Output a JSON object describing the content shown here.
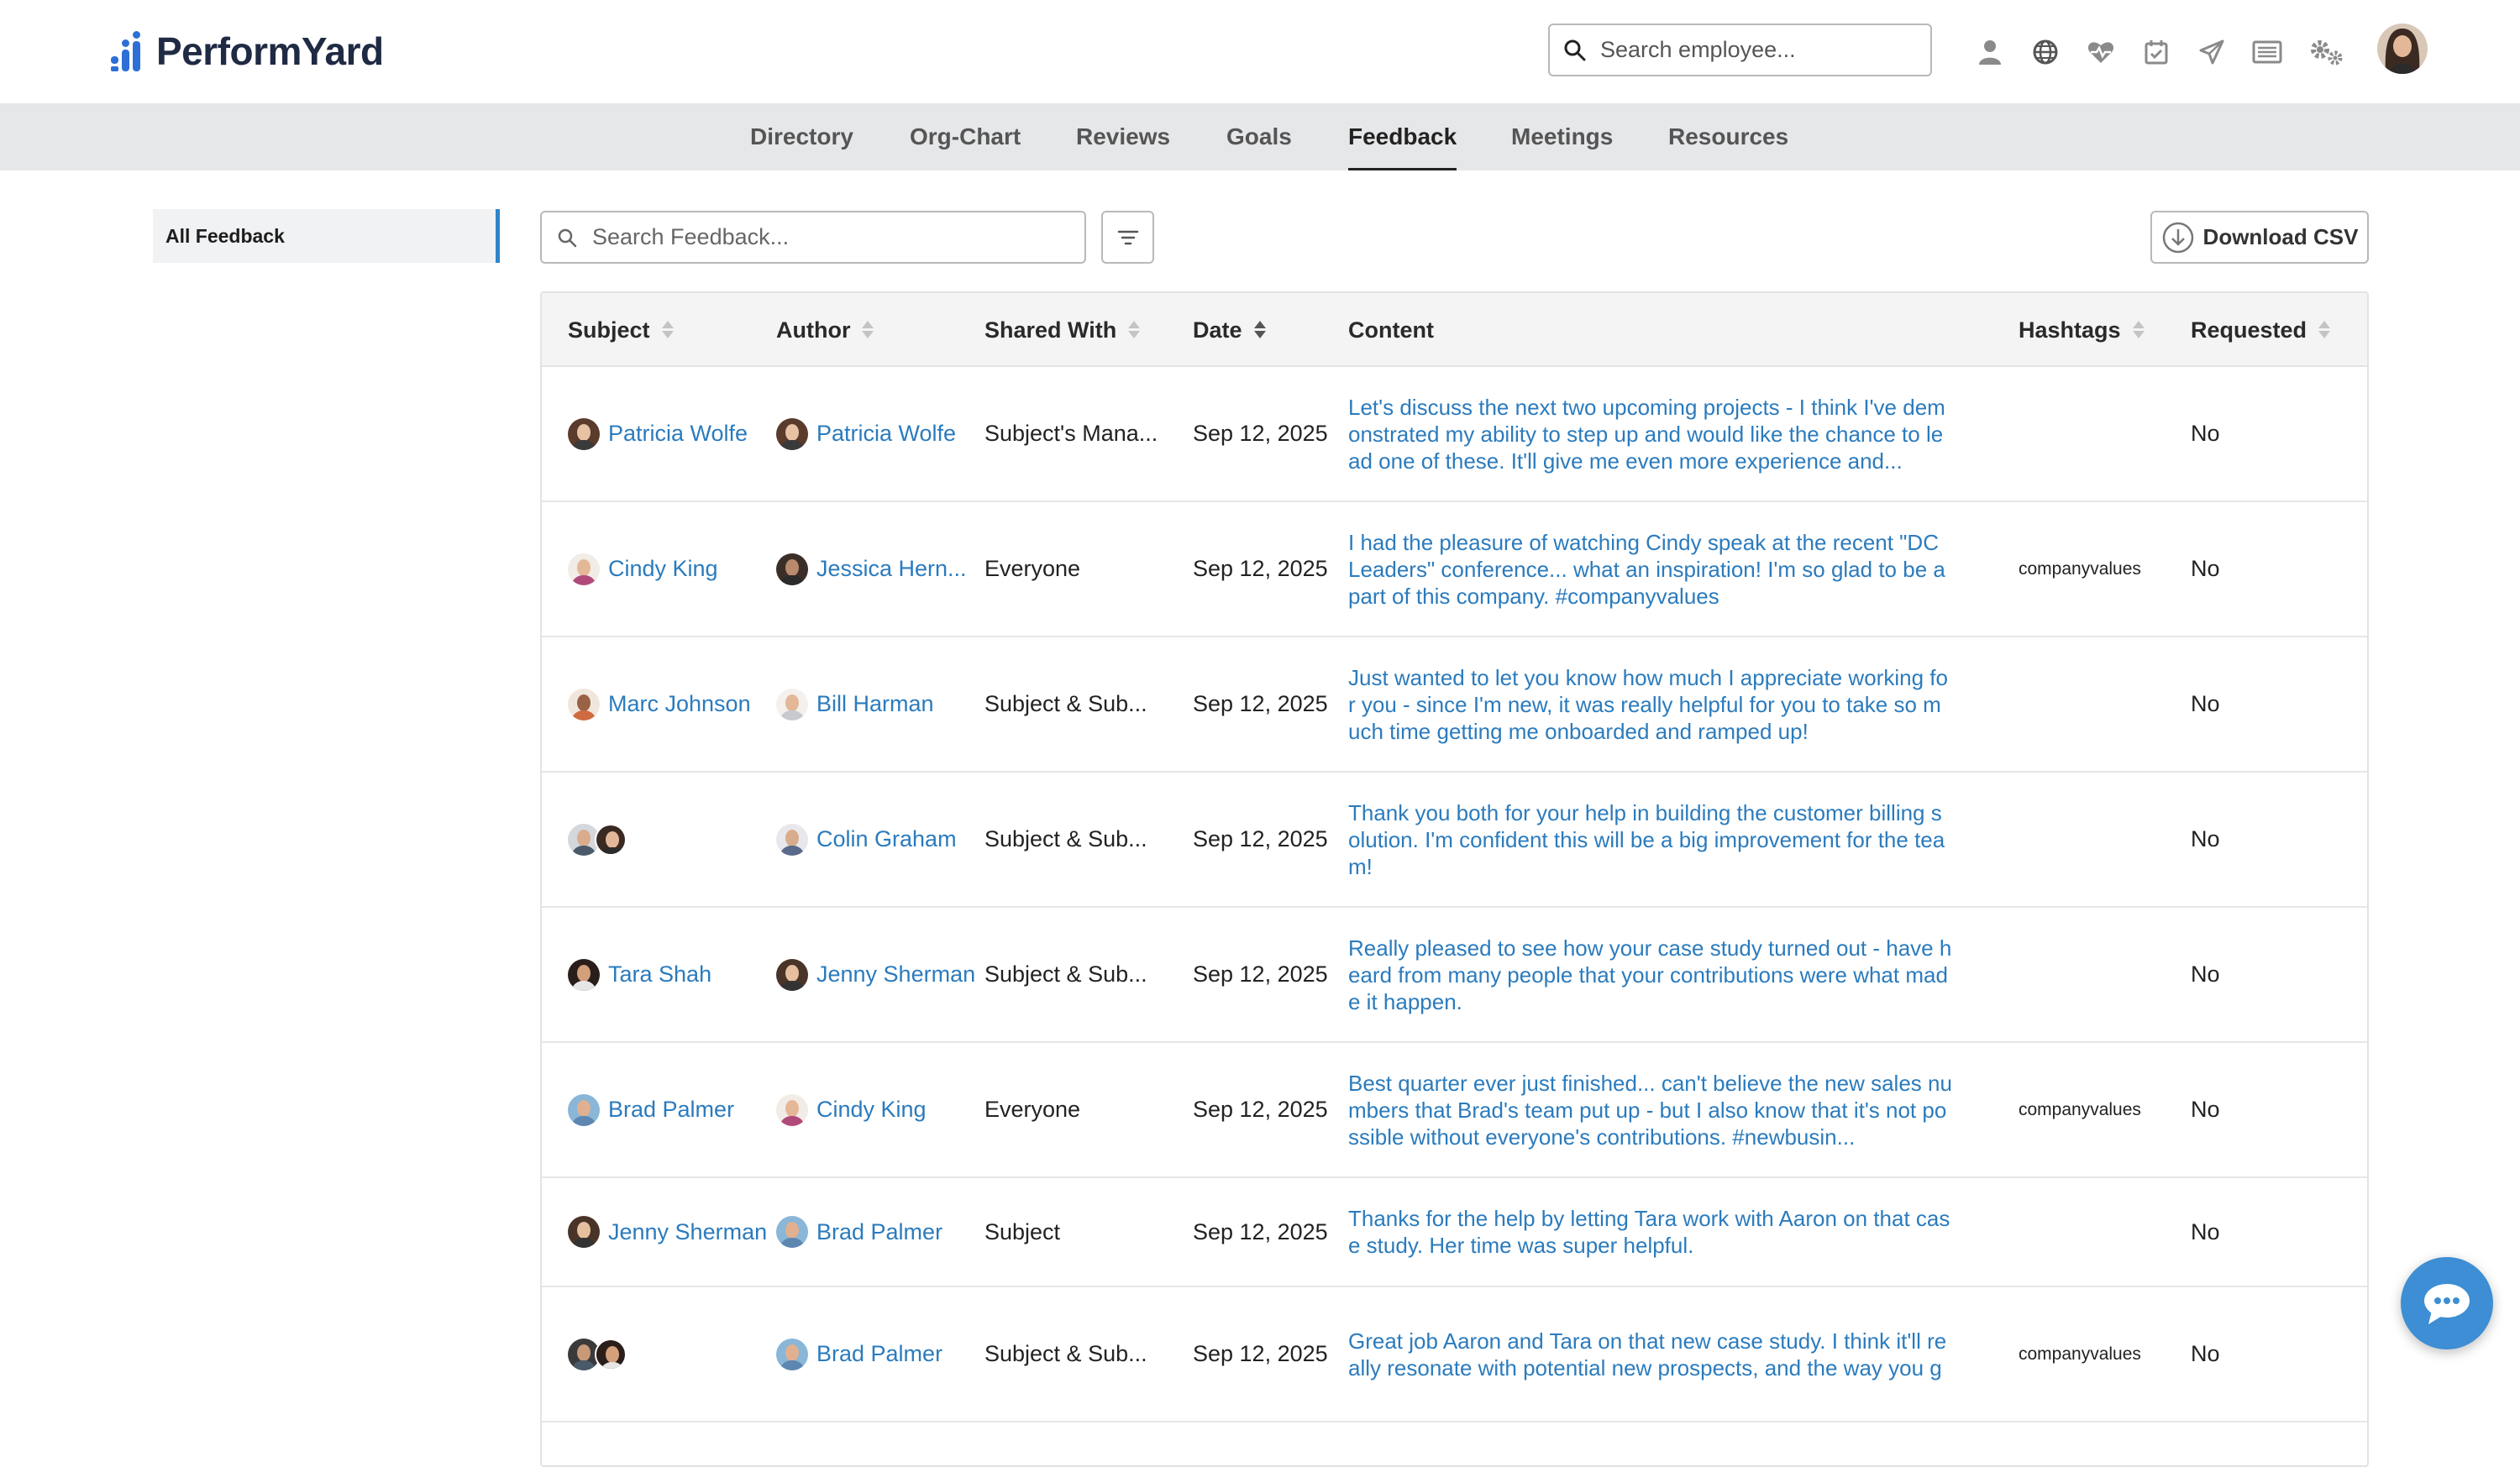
{
  "app": {
    "logo_text": "PerformYard",
    "brand_color": "#2d6fd6"
  },
  "header": {
    "search_placeholder": "Search employee...",
    "icons": [
      "person-icon",
      "globe-icon",
      "heart-pulse-icon",
      "calendar-check-icon",
      "paper-plane-icon",
      "news-icon",
      "gears-icon"
    ]
  },
  "nav": {
    "tabs": [
      {
        "label": "Directory",
        "active": false
      },
      {
        "label": "Org-Chart",
        "active": false
      },
      {
        "label": "Reviews",
        "active": false
      },
      {
        "label": "Goals",
        "active": false
      },
      {
        "label": "Feedback",
        "active": true
      },
      {
        "label": "Meetings",
        "active": false
      },
      {
        "label": "Resources",
        "active": false
      }
    ]
  },
  "sidebar": {
    "items": [
      {
        "label": "All Feedback",
        "active": true
      }
    ]
  },
  "toolbar": {
    "search_placeholder": "Search Feedback...",
    "download_label": "Download CSV"
  },
  "table": {
    "headers": {
      "subject": "Subject",
      "author": "Author",
      "shared_with": "Shared With",
      "date": "Date",
      "content": "Content",
      "hashtags": "Hashtags",
      "requested": "Requested"
    },
    "rows": [
      {
        "subject": "Patricia Wolfe",
        "author": "Patricia Wolfe",
        "shared_with": "Subject's Mana...",
        "date": "Sep 12, 2025",
        "content": "Let's discuss the next two upcoming projects - I think I've demonstrated my ability to step up and would like the chance to lead one of these. It'll give me even more experience and...",
        "hashtags": "",
        "requested": "No"
      },
      {
        "subject": "Cindy King",
        "author": "Jessica Hern...",
        "shared_with": "Everyone",
        "date": "Sep 12, 2025",
        "content": "I had the pleasure of watching Cindy speak at the recent \"DC Leaders\" conference... what an inspiration! I'm so glad to be a part of this company. #companyvalues",
        "hashtags": "companyvalues",
        "requested": "No"
      },
      {
        "subject": "Marc Johnson",
        "author": "Bill Harman",
        "shared_with": "Subject & Sub...",
        "date": "Sep 12, 2025",
        "content": "Just wanted to let you know how much I appreciate working for you - since I'm new, it was really helpful for you to take so much time getting me onboarded and ramped up!",
        "hashtags": "",
        "requested": "No"
      },
      {
        "subject": "",
        "author": "Colin Graham",
        "shared_with": "Subject & Sub...",
        "date": "Sep 12, 2025",
        "content": "Thank you both for your help in building the customer billing solution. I'm confident this will be a big improvement for the team!",
        "hashtags": "",
        "requested": "No"
      },
      {
        "subject": "Tara Shah",
        "author": "Jenny Sherman",
        "shared_with": "Subject & Sub...",
        "date": "Sep 12, 2025",
        "content": "Really pleased to see how your case study turned out - have heard from many people that your contributions were what made it happen.",
        "hashtags": "",
        "requested": "No"
      },
      {
        "subject": "Brad Palmer",
        "author": "Cindy King",
        "shared_with": "Everyone",
        "date": "Sep 12, 2025",
        "content": "Best quarter ever just finished... can't believe the new sales numbers that Brad's team put up - but I also know that it's not possible without everyone's contributions. #newbusin...",
        "hashtags": "companyvalues",
        "requested": "No"
      },
      {
        "subject": "Jenny Sherman",
        "author": "Brad Palmer",
        "shared_with": "Subject",
        "date": "Sep 12, 2025",
        "content": "Thanks for the help by letting Tara work with Aaron on that case study. Her time was super helpful.",
        "hashtags": "",
        "requested": "No"
      },
      {
        "subject": "",
        "author": "Brad Palmer",
        "shared_with": "Subject & Sub...",
        "date": "Sep 12, 2025",
        "content": "Great job Aaron and Tara on that new case study. I think it'll really resonate with potential new prospects, and the way you g",
        "hashtags": "companyvalues",
        "requested": "No"
      }
    ]
  }
}
